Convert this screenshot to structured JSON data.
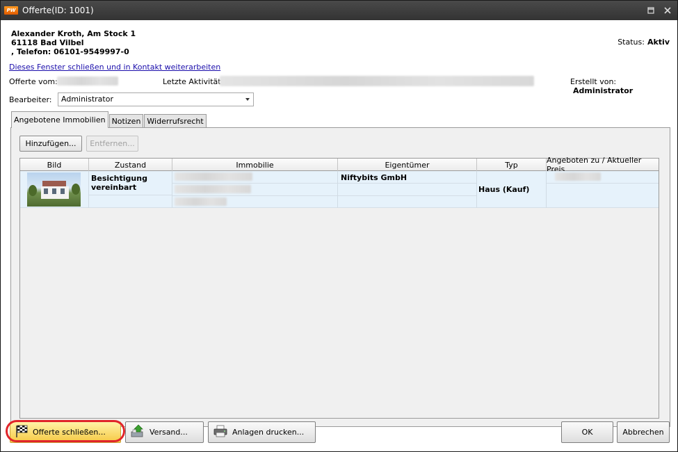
{
  "window": {
    "title": "Offerte(ID: 1001)",
    "app_icon_text": "PW"
  },
  "contact": {
    "line1": "Alexander Kroth, Am Stock 1",
    "line2": "61118 Bad Vilbel",
    "line3": ", Telefon: 06101-9549997-0"
  },
  "status": {
    "label": "Status:",
    "value": "Aktiv"
  },
  "link_text": "Dieses Fenster schließen und in Kontakt weiterarbeiten",
  "info_row": {
    "offerte_vom_label": "Offerte vom:",
    "letzte_aktivitaet_label": "Letzte Aktivität:",
    "erstellt_von_label": "Erstellt von:",
    "erstellt_von_value": "Administrator"
  },
  "bearbeiter": {
    "label": "Bearbeiter:",
    "value": "Administrator"
  },
  "tabs": [
    {
      "label": "Angebotene Immobilien",
      "active": true
    },
    {
      "label": "Notizen",
      "active": false
    },
    {
      "label": "Widerrufsrecht",
      "active": false
    }
  ],
  "panel_buttons": {
    "add": "Hinzufügen...",
    "remove": "Entfernen..."
  },
  "grid": {
    "columns": [
      "Bild",
      "Zustand",
      "Immobilie",
      "Eigentümer",
      "Typ",
      "Angeboten zu / Aktueller Preis"
    ],
    "rows": [
      {
        "zustand": "Besichtigung vereinbart",
        "eigentuemer": "Niftybits GmbH",
        "typ": "Haus (Kauf)"
      }
    ]
  },
  "bottom_buttons": {
    "close_offer": "Offerte schließen...",
    "versand": "Versand...",
    "print": "Anlagen drucken...",
    "ok": "OK",
    "cancel": "Abbrechen"
  }
}
